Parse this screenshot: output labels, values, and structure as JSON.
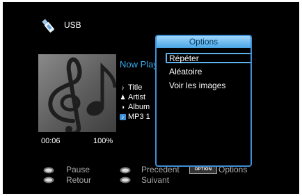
{
  "source": {
    "label": "USB",
    "icon": "usb-stick-icon"
  },
  "album_art": {
    "icon": "music-notes-icon"
  },
  "now_playing": {
    "label": "Now Playing"
  },
  "track": {
    "title": "Title",
    "artist": "Artist",
    "album": "Album",
    "format": "MP3 1"
  },
  "playback": {
    "elapsed": "00:06",
    "progress": "100%"
  },
  "hints": {
    "pause": "Pause",
    "back": "Retour",
    "previous": "Precedent",
    "next": "Suivant",
    "option_badge": "OPTION",
    "options": "Options"
  },
  "options_menu": {
    "title": "Options",
    "items": [
      "Répéter",
      "Aléatoire",
      "Voir les images"
    ],
    "selected_index": 0
  },
  "colors": {
    "accent": "#3aa8e8",
    "menu_border": "#3e8fd6",
    "background": "#000000"
  }
}
